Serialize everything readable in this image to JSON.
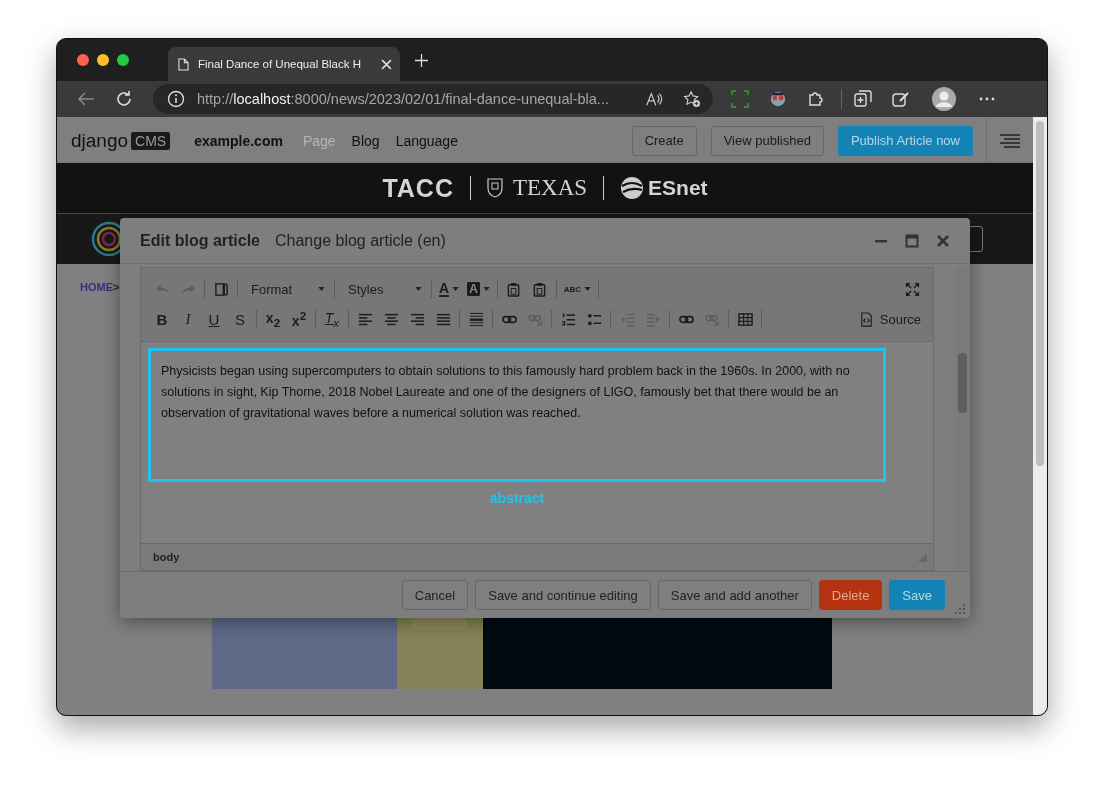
{
  "browser": {
    "tab_title": "Final Dance of Unequal Black H",
    "url": {
      "scheme": "http://",
      "host": "localhost",
      "path": ":8000/news/2023/02/01/final-dance-unequal-bla..."
    }
  },
  "cms_toolbar": {
    "logo": "django",
    "logo_badge": "CMS",
    "site": "example.com",
    "menu": [
      {
        "label": "Page",
        "disabled": true
      },
      {
        "label": "Blog",
        "disabled": false
      },
      {
        "label": "Language",
        "disabled": false
      }
    ],
    "buttons": [
      {
        "label": "Create",
        "primary": false
      },
      {
        "label": "View published",
        "primary": false
      },
      {
        "label": "Publish Article now",
        "primary": true
      }
    ]
  },
  "partners": [
    "TACC",
    "TEXAS",
    "ESnet"
  ],
  "breadcrumb": {
    "link": "HOME",
    "separator": ">"
  },
  "modal": {
    "title": "Edit blog article",
    "subtitle": "Change blog article (en)",
    "toolbar": {
      "rows": [
        {
          "groups": [
            [
              {
                "kind": "undo",
                "disabled": true
              },
              {
                "kind": "redo",
                "disabled": true
              }
            ],
            [
              {
                "kind": "templates",
                "disabled": false
              }
            ],
            [
              {
                "kind": "combo",
                "text": "Format",
                "disabled": false
              }
            ],
            [
              {
                "kind": "combo",
                "text": "Styles",
                "disabled": false
              }
            ],
            [
              {
                "kind": "textcolor",
                "text": "A",
                "disabled": false
              },
              {
                "kind": "bgcolor",
                "text": "A",
                "disabled": false
              }
            ],
            [
              {
                "kind": "pastetext",
                "disabled": false
              },
              {
                "kind": "pasteword",
                "disabled": false
              }
            ],
            [
              {
                "kind": "spellcheck",
                "text": "ABC",
                "disabled": false
              }
            ]
          ],
          "right": [
            {
              "kind": "maximize",
              "disabled": false
            }
          ]
        },
        {
          "groups": [
            [
              {
                "kind": "bold",
                "text": "B",
                "disabled": false
              },
              {
                "kind": "italic",
                "text": "I",
                "disabled": false
              },
              {
                "kind": "underline",
                "text": "U",
                "disabled": false
              },
              {
                "kind": "strike",
                "text": "S",
                "disabled": false
              }
            ],
            [
              {
                "kind": "subscript",
                "text": "x$_{2}$",
                "disabled": false
              },
              {
                "kind": "superscript",
                "text": "x$^{2}$",
                "disabled": false
              }
            ],
            [
              {
                "kind": "removeformat",
                "text": "T$_{x}$",
                "disabled": false
              }
            ],
            [
              {
                "kind": "alignleft",
                "disabled": false
              },
              {
                "kind": "aligncenter",
                "disabled": false
              },
              {
                "kind": "alignright",
                "disabled": false
              },
              {
                "kind": "justify",
                "disabled": false
              }
            ],
            [
              {
                "kind": "hr",
                "disabled": false
              }
            ],
            [
              {
                "kind": "link",
                "disabled": false
              },
              {
                "kind": "unlink",
                "disabled": true
              }
            ],
            [
              {
                "kind": "numbered",
                "disabled": false
              },
              {
                "kind": "bulleted",
                "disabled": false
              }
            ],
            [
              {
                "kind": "outdent",
                "disabled": true
              },
              {
                "kind": "indent",
                "disabled": true
              }
            ],
            [
              {
                "kind": "link",
                "disabled": false
              },
              {
                "kind": "unlink",
                "disabled": true
              }
            ],
            [
              {
                "kind": "table",
                "disabled": false
              }
            ]
          ],
          "right": [
            {
              "kind": "source",
              "text": "Source",
              "disabled": false
            }
          ]
        }
      ]
    },
    "field": {
      "text": "Physicists began using supercomputers to obtain solutions to this famously hard problem back in the 1960s. In 2000, with no solutions in sight, Kip Thorne, 2018 Nobel Laureate and one of the designers of LIGO, famously bet that there would be an observation of gravitational waves before a numerical solution was reached.",
      "label": "abstract"
    },
    "path": "body",
    "buttons": [
      {
        "label": "Cancel",
        "kind": "default"
      },
      {
        "label": "Save and continue editing",
        "kind": "default"
      },
      {
        "label": "Save and add another",
        "kind": "default"
      },
      {
        "label": "Delete",
        "kind": "danger"
      },
      {
        "label": "Save",
        "kind": "primary"
      }
    ]
  }
}
